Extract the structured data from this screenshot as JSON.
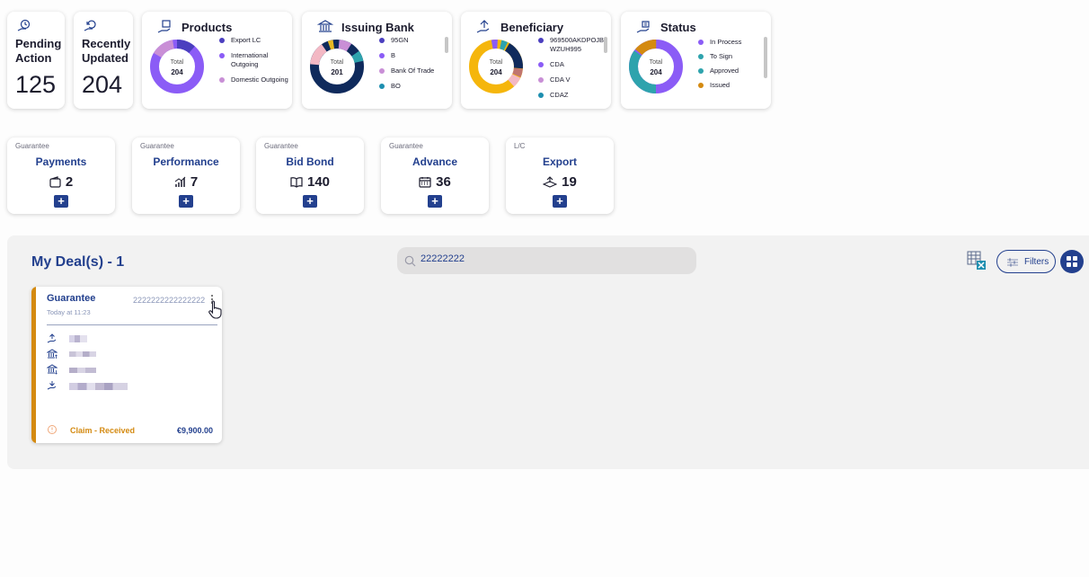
{
  "stats": {
    "pending": {
      "label_line1": "Pending",
      "label_line2": "Action",
      "value": "125"
    },
    "updated": {
      "label_line1": "Recently",
      "label_line2": "Updated",
      "value": "204"
    }
  },
  "charts": {
    "products": {
      "title": "Products",
      "center_label": "Total",
      "center_value": "204",
      "legend": [
        "Export LC",
        "International Outgoing",
        "Domestic Outgoing"
      ]
    },
    "issuing_bank": {
      "title": "Issuing Bank",
      "center_label": "Total",
      "center_value": "201",
      "legend": [
        "95GN",
        "B",
        "Bank Of Trade",
        "BO"
      ]
    },
    "beneficiary": {
      "title": "Beneficiary",
      "center_label": "Total",
      "center_value": "204",
      "legend": [
        "969500AKDPOJB WZUH995",
        "CDA",
        "CDA V",
        "CDAZ"
      ]
    },
    "status": {
      "title": "Status",
      "center_label": "Total",
      "center_value": "204",
      "legend": [
        "In Process",
        "To Sign",
        "Approved",
        "Issued"
      ]
    }
  },
  "colors": {
    "brand": "#23408e",
    "purple": "#8b5cf6",
    "violet": "#4b3fbf",
    "orchid": "#c98fd6",
    "teal": "#2ea3ad",
    "amber": "#d48a11",
    "navy": "#0f2a5c",
    "pink": "#f3b8c4"
  },
  "products": [
    {
      "category": "Guarantee",
      "name": "Payments",
      "count": "2",
      "icon": "wallet-icon"
    },
    {
      "category": "Guarantee",
      "name": "Performance",
      "count": "7",
      "icon": "bar-chart-icon"
    },
    {
      "category": "Guarantee",
      "name": "Bid Bond",
      "count": "140",
      "icon": "book-icon"
    },
    {
      "category": "Guarantee",
      "name": "Advance",
      "count": "36",
      "icon": "calendar-icon"
    },
    {
      "category": "L/C",
      "name": "Export",
      "count": "19",
      "icon": "export-box-icon"
    }
  ],
  "plus_label": "+",
  "deals": {
    "title": "My Deal(s) - 1",
    "search_value": "22222222",
    "filters_label": "Filters",
    "card": {
      "type": "Guarantee",
      "time": "Today at 11:23",
      "reference": "2222222222222222",
      "status": "Claim - Received",
      "amount": "€9,900.00"
    }
  }
}
